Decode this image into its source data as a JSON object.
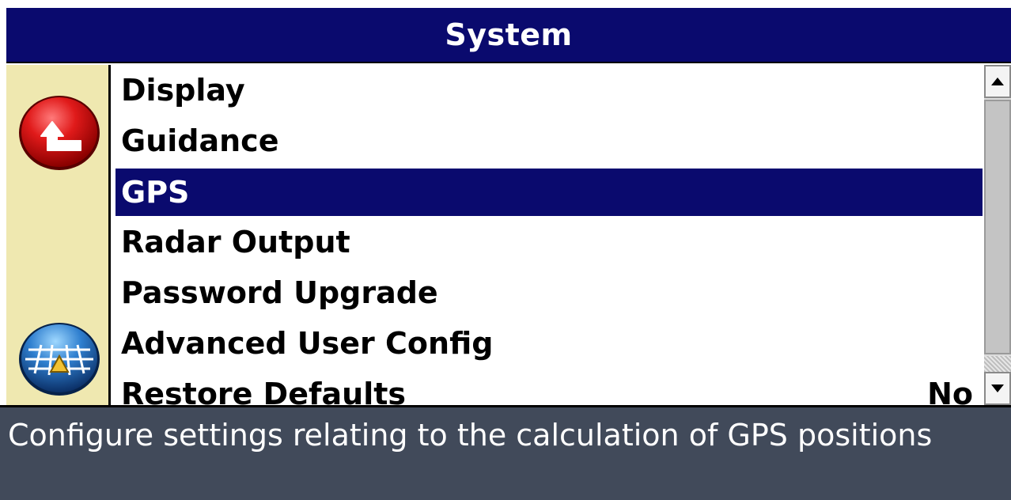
{
  "window": {
    "title": "System"
  },
  "sidebar": {
    "back_icon": "back-arrow-icon",
    "map_icon": "field-map-icon"
  },
  "menu": {
    "items": [
      {
        "label": "Display",
        "value": "",
        "selected": false
      },
      {
        "label": "Guidance",
        "value": "",
        "selected": false
      },
      {
        "label": "GPS",
        "value": "",
        "selected": true
      },
      {
        "label": "Radar Output",
        "value": "",
        "selected": false
      },
      {
        "label": "Password Upgrade",
        "value": "",
        "selected": false
      },
      {
        "label": "Advanced User Config",
        "value": "",
        "selected": false
      },
      {
        "label": "Restore Defaults",
        "value": "No",
        "selected": false
      }
    ]
  },
  "status": {
    "description": "Configure settings relating to the calculation of GPS positions"
  },
  "colors": {
    "title_bg": "#0a0a6e",
    "selection_bg": "#0a0a6e",
    "sidebar_bg": "#efe8b0",
    "status_bg": "#414a5a"
  }
}
